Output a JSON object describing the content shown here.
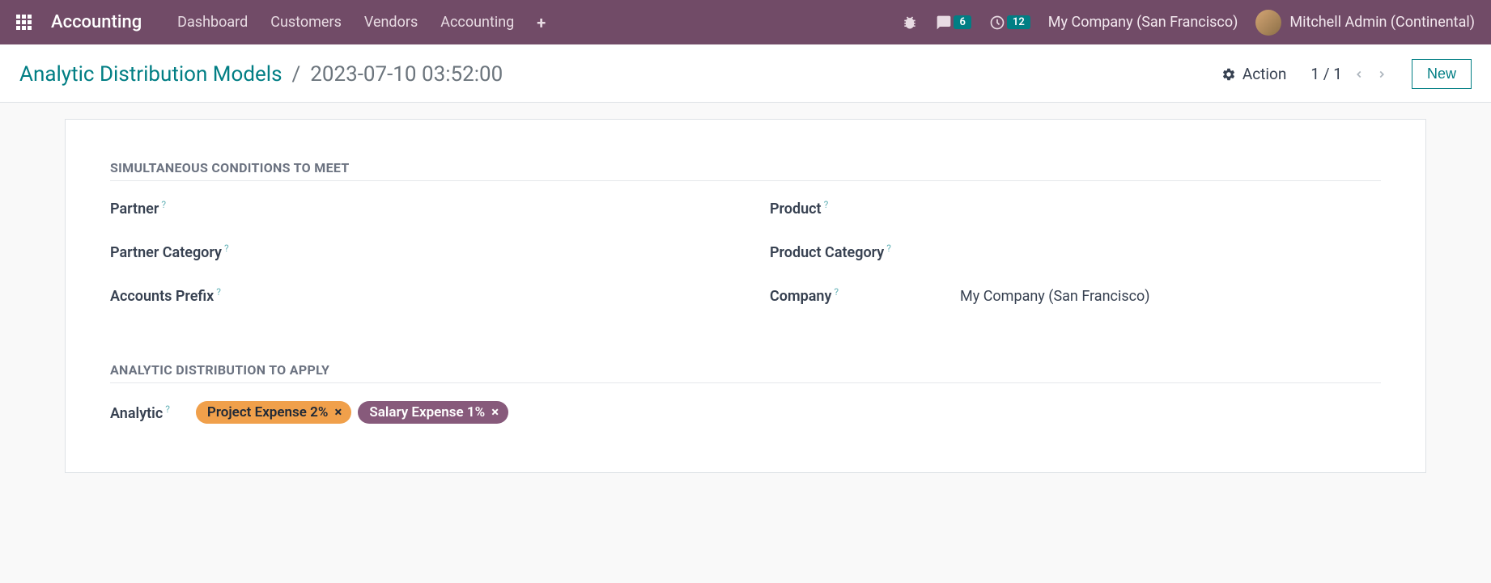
{
  "navbar": {
    "brand": "Accounting",
    "menu": [
      "Dashboard",
      "Customers",
      "Vendors",
      "Accounting"
    ],
    "messages_badge": "6",
    "activities_badge": "12",
    "company": "My Company (San Francisco)",
    "user": "Mitchell Admin (Continental)"
  },
  "breadcrumb": {
    "parent": "Analytic Distribution Models",
    "current": "2023-07-10 03:52:00"
  },
  "controls": {
    "action_label": "Action",
    "pager": "1 / 1",
    "new_label": "New"
  },
  "sections": {
    "conditions_title": "SIMULTANEOUS CONDITIONS TO MEET",
    "distribution_title": "ANALYTIC DISTRIBUTION TO APPLY"
  },
  "fields": {
    "partner_label": "Partner",
    "partner_value": "",
    "partner_category_label": "Partner Category",
    "partner_category_value": "",
    "accounts_prefix_label": "Accounts Prefix",
    "accounts_prefix_value": "",
    "product_label": "Product",
    "product_value": "",
    "product_category_label": "Product Category",
    "product_category_value": "",
    "company_label": "Company",
    "company_value": "My Company (San Francisco)",
    "analytic_label": "Analytic"
  },
  "analytic_tags": [
    {
      "label": "Project Expense 2%",
      "color": "orange"
    },
    {
      "label": "Salary Expense 1%",
      "color": "purple"
    }
  ]
}
